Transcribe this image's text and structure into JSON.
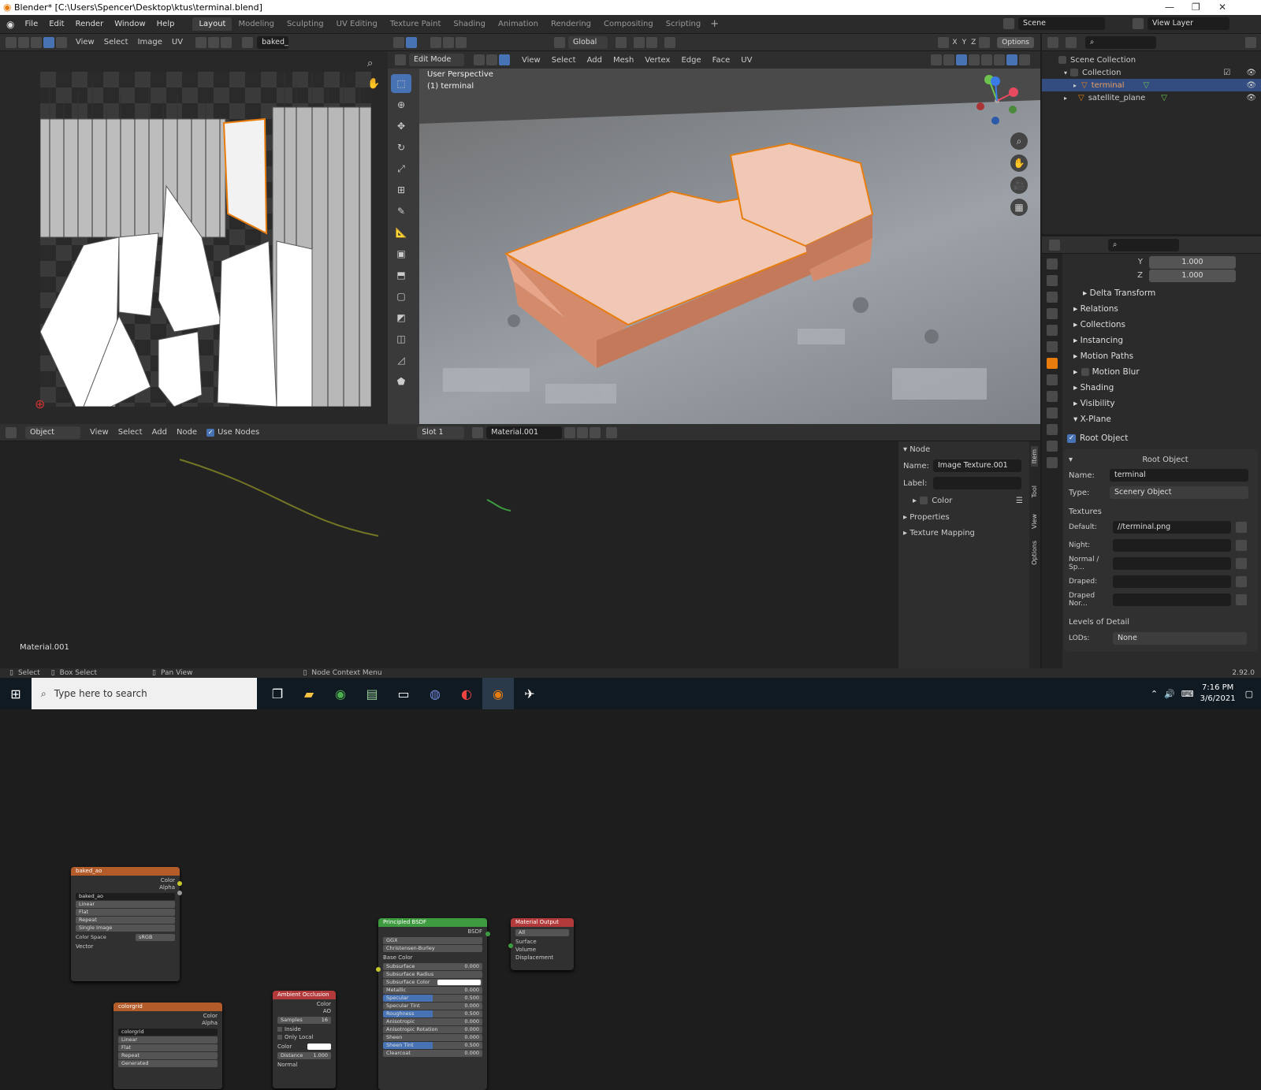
{
  "window": {
    "title": "Blender* [C:\\Users\\Spencer\\Desktop\\ktus\\terminal.blend]"
  },
  "menu": [
    "File",
    "Edit",
    "Render",
    "Window",
    "Help"
  ],
  "workspaces": [
    "Layout",
    "Modeling",
    "Sculpting",
    "UV Editing",
    "Texture Paint",
    "Shading",
    "Animation",
    "Rendering",
    "Compositing",
    "Scripting"
  ],
  "scene": {
    "name": "Scene",
    "view_layer": "View Layer"
  },
  "uv_editor": {
    "menu": [
      "View",
      "Select",
      "Image",
      "UV"
    ],
    "image_name": "baked_"
  },
  "viewport": {
    "transform": "Global",
    "mode": "Edit Mode",
    "menu": [
      "View",
      "Select",
      "Add",
      "Mesh",
      "Vertex",
      "Edge",
      "Face",
      "UV"
    ],
    "perspective": "User Perspective",
    "object": "(1) terminal",
    "options": "Options",
    "axes": [
      "X",
      "Y",
      "Z"
    ]
  },
  "outliner": {
    "root": "Scene Collection",
    "collection": "Collection",
    "items": [
      "terminal",
      "satellite_plane"
    ]
  },
  "properties": {
    "scale_y_label": "Y",
    "scale_y": "1.000",
    "scale_z_label": "Z",
    "scale_z": "1.000",
    "sections": [
      "Delta Transform",
      "Relations",
      "Collections",
      "Instancing",
      "Motion Paths",
      "Motion Blur",
      "Shading",
      "Visibility",
      "X-Plane"
    ],
    "root_object_check": "Root Object",
    "root_object_panel": "Root Object",
    "name_label": "Name:",
    "name_value": "terminal",
    "type_label": "Type:",
    "type_value": "Scenery Object",
    "textures_label": "Textures",
    "default_label": "Default:",
    "default_value": "//terminal.png",
    "night_label": "Night:",
    "normal_label": "Normal / Sp...",
    "draped_label": "Draped:",
    "draped_nor_label": "Draped Nor...",
    "lod_section": "Levels of Detail",
    "lods_label": "LODs:",
    "lods_value": "None"
  },
  "node_editor": {
    "mode": "Object",
    "menu": [
      "View",
      "Select",
      "Add",
      "Node"
    ],
    "use_nodes": "Use Nodes",
    "slot": "Slot 1",
    "material": "Material.001",
    "material_label": "Material.001"
  },
  "node_sidebar": {
    "header": "Node",
    "name_label": "Name:",
    "name_value": "Image Texture.001",
    "label_label": "Label:",
    "color_label": "Color",
    "properties": "Properties",
    "texture_mapping": "Texture Mapping",
    "tabs": [
      "Item",
      "Tool",
      "View",
      "Options"
    ]
  },
  "nodes": {
    "baked": {
      "title": "baked_ao",
      "out_color": "Color",
      "out_alpha": "Alpha",
      "image": "baked_ao",
      "interp": "Linear",
      "proj": "Flat",
      "ext": "Repeat",
      "src": "Single Image",
      "cs_label": "Color Space",
      "cs_value": "sRGB",
      "vector": "Vector"
    },
    "colorgrid": {
      "title": "colorgrid",
      "out_color": "Color",
      "out_alpha": "Alpha",
      "image": "colorgrid",
      "interp": "Linear",
      "proj": "Flat",
      "ext": "Repeat",
      "src": "Generated"
    },
    "ao": {
      "title": "Ambient Occlusion",
      "out_color": "Color",
      "out_ao": "AO",
      "samples_label": "Samples",
      "samples": "16",
      "inside": "Inside",
      "only_local": "Only Local",
      "color": "Color",
      "distance_label": "Distance",
      "distance": "1.000",
      "normal": "Normal"
    },
    "bsdf": {
      "title": "Principled BSDF",
      "out": "BSDF",
      "dist": "GGX",
      "sss": "Christensen-Burley",
      "base_color": "Base Color",
      "rows": [
        {
          "label": "Subsurface",
          "value": "0.000"
        },
        {
          "label": "Subsurface Radius",
          "value": ""
        },
        {
          "label": "Subsurface Color",
          "value": ""
        },
        {
          "label": "Metallic",
          "value": "0.000"
        },
        {
          "label": "Specular",
          "value": "0.500"
        },
        {
          "label": "Specular Tint",
          "value": "0.000"
        },
        {
          "label": "Roughness",
          "value": "0.500"
        },
        {
          "label": "Anisotropic",
          "value": "0.000"
        },
        {
          "label": "Anisotropic Rotation",
          "value": "0.000"
        },
        {
          "label": "Sheen",
          "value": "0.000"
        },
        {
          "label": "Sheen Tint",
          "value": "0.500"
        },
        {
          "label": "Clearcoat",
          "value": "0.000"
        }
      ]
    },
    "output": {
      "title": "Material Output",
      "target": "All",
      "surface": "Surface",
      "volume": "Volume",
      "displacement": "Displacement"
    }
  },
  "status": {
    "select": "Select",
    "box_select": "Box Select",
    "pan_view": "Pan View",
    "context": "Node Context Menu",
    "version": "2.92.0"
  },
  "taskbar": {
    "search": "Type here to search",
    "time": "7:16 PM",
    "date": "3/6/2021"
  },
  "colors": {
    "accent": "#4772b3",
    "selection": "#e87d0d",
    "header_node_tex": "#b35c2a",
    "header_shader": "#3f9b3f",
    "header_output": "#b33a3a"
  }
}
